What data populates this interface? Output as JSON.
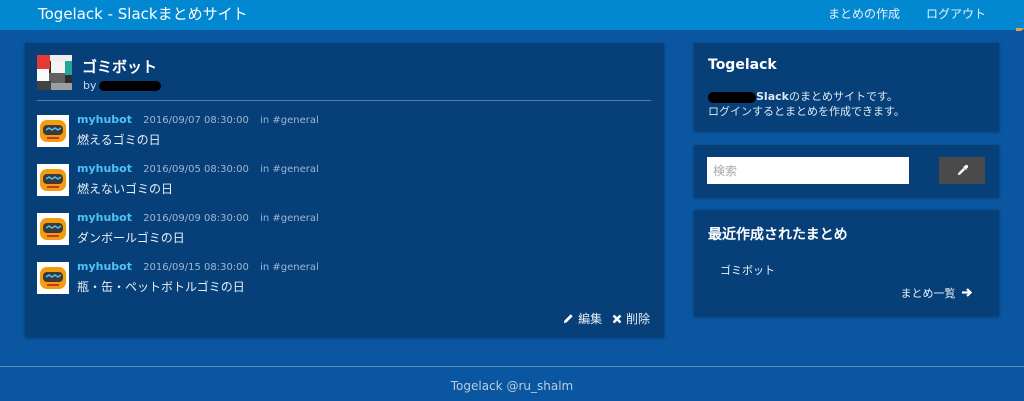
{
  "navbar": {
    "brand": "Togelack - Slackまとめサイト",
    "create_summary": "まとめの作成",
    "logout": "ログアウト"
  },
  "summary": {
    "title": "ゴミボット",
    "by_prefix": "by",
    "messages": [
      {
        "user": "myhubot",
        "time": "2016/09/07 08:30:00",
        "channel": "in #general",
        "text": "燃えるゴミの日"
      },
      {
        "user": "myhubot",
        "time": "2016/09/05 08:30:00",
        "channel": "in #general",
        "text": "燃えないゴミの日"
      },
      {
        "user": "myhubot",
        "time": "2016/09/09 08:30:00",
        "channel": "in #general",
        "text": "ダンボールゴミの日"
      },
      {
        "user": "myhubot",
        "time": "2016/09/15 08:30:00",
        "channel": "in #general",
        "text": "瓶・缶・ペットボトルゴミの日"
      }
    ],
    "edit_label": "編集",
    "delete_label": "削除"
  },
  "about": {
    "title": "Togelack",
    "line1_slack": "Slack",
    "line1_rest": "のまとめサイトです。",
    "line2": "ログインするとまとめを作成できます。"
  },
  "search": {
    "placeholder": "検索",
    "value": ""
  },
  "recent": {
    "title": "最近作成されたまとめ",
    "items": [
      "ゴミボット"
    ],
    "all_label": "まとめ一覧"
  },
  "footer": {
    "text": "Togelack @ru_shalm"
  },
  "colors": {
    "background": "#0a56a0",
    "navbar": "#0288d1",
    "panel": "#073f78",
    "username": "#4fc3f7"
  },
  "icons": {
    "summary_avatar": "summary-avatar-icon",
    "bot_avatar": "bot-avatar-icon",
    "edit": "pencil-icon",
    "delete": "x-icon",
    "search": "eyedropper-icon",
    "arrow": "arrow-right-icon"
  }
}
